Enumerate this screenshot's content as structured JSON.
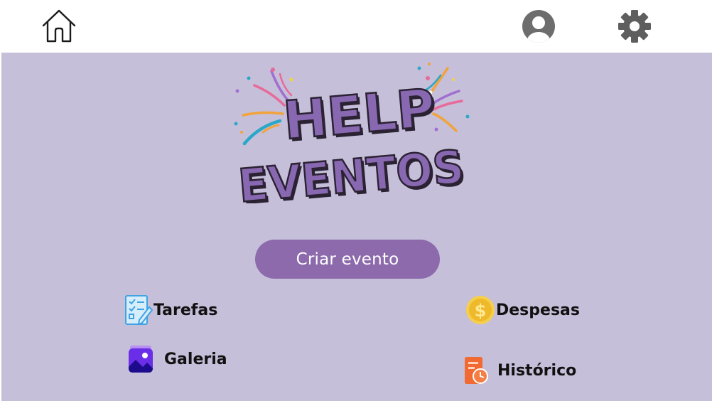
{
  "header": {
    "home_icon": "home-icon",
    "profile_icon": "user-avatar-icon",
    "settings_icon": "gear-icon"
  },
  "logo": {
    "line1": "HELP",
    "line2": "EVENTOS",
    "colors": {
      "text": "#8868b0",
      "outline": "#2b2233",
      "confetti": [
        "#e86a9a",
        "#f2a33a",
        "#2aa7c9",
        "#a06fd0",
        "#f5d33b"
      ]
    }
  },
  "actions": {
    "create_event": "Criar evento"
  },
  "features": {
    "tarefas": "Tarefas",
    "despesas": "Despesas",
    "galeria": "Galeria",
    "historico": "Histórico"
  },
  "colors": {
    "background": "#c6bfd9",
    "topbar": "#ffffff",
    "button": "#8c6aab"
  }
}
